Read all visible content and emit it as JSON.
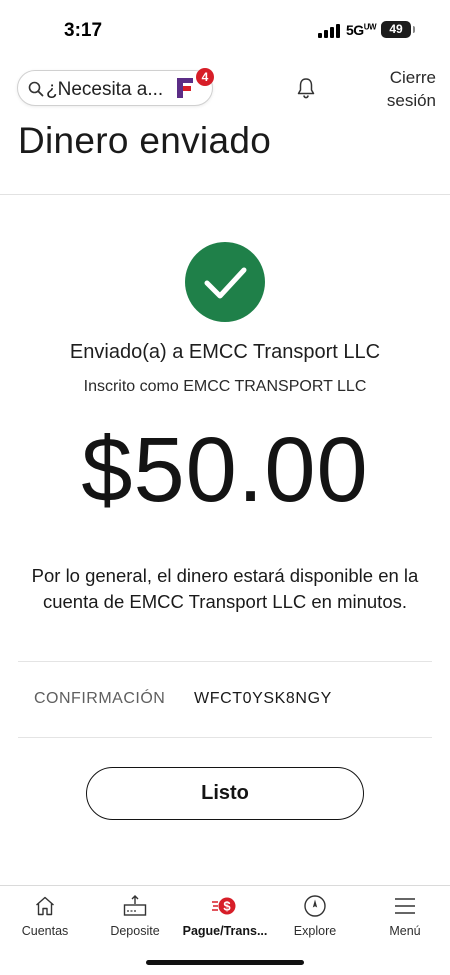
{
  "status_bar": {
    "time": "3:17",
    "network": "5G",
    "network_sup": "UW",
    "battery": "49"
  },
  "header": {
    "search_placeholder": "¿Necesita a...",
    "fargo_badge_count": "4",
    "signout_label": "Cierre sesión"
  },
  "page": {
    "title": "Dinero enviado"
  },
  "confirmation": {
    "sent_to": "Enviado(a) a EMCC Transport LLC",
    "enrolled_as": "Inscrito como EMCC TRANSPORT LLC",
    "amount": "$50.00",
    "availability": "Por lo general, el dinero estará disponible en la cuenta de EMCC Transport LLC en minutos.",
    "confirmation_label": "CONFIRMACIÓN",
    "confirmation_number": "WFCT0YSK8NGY",
    "done_button": "Listo"
  },
  "tabs": [
    {
      "label": "Cuentas",
      "icon": "home-icon"
    },
    {
      "label": "Deposite",
      "icon": "deposit-icon"
    },
    {
      "label": "Pague/Trans...",
      "icon": "pay-transfer-icon",
      "active": true
    },
    {
      "label": "Explore",
      "icon": "compass-icon"
    },
    {
      "label": "Menú",
      "icon": "menu-icon"
    }
  ],
  "colors": {
    "success_green": "#1f8049",
    "brand_red": "#d71e28",
    "fargo_purple": "#5b2d86"
  }
}
